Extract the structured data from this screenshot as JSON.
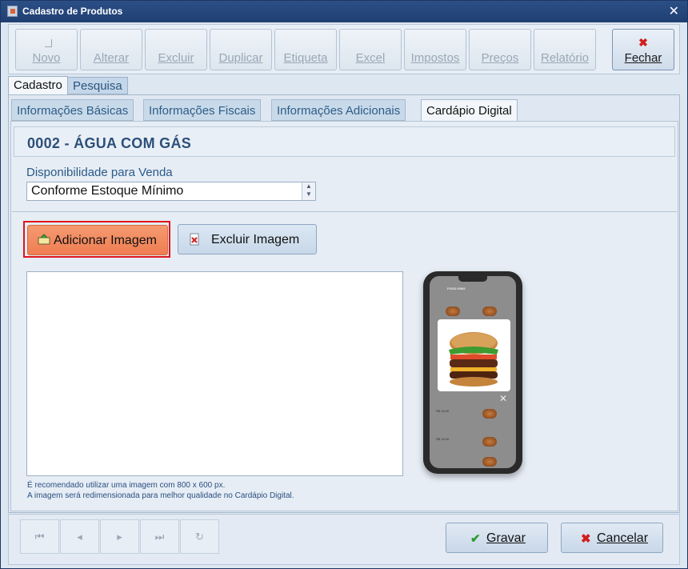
{
  "window": {
    "title": "Cadastro de Produtos",
    "close_glyph": "✕"
  },
  "toolbar": {
    "buttons": [
      {
        "label": "Novo",
        "enabled": false
      },
      {
        "label": "Alterar",
        "enabled": false
      },
      {
        "label": "Excluir",
        "enabled": false
      },
      {
        "label": "Duplicar",
        "enabled": false
      },
      {
        "label": "Etiqueta",
        "enabled": false
      },
      {
        "label": "Excel",
        "enabled": false
      },
      {
        "label": "Impostos",
        "enabled": false
      },
      {
        "label": "Preços",
        "enabled": false
      },
      {
        "label": "Relatório",
        "enabled": false
      }
    ],
    "close_label": "Fechar",
    "close_icon": "red-x-icon"
  },
  "main_tabs": [
    {
      "label": "Cadastro",
      "selected": true
    },
    {
      "label": "Pesquisa",
      "selected": false
    }
  ],
  "sub_tabs": [
    {
      "label": "Informações Básicas",
      "selected": false
    },
    {
      "label": "Informações Fiscais",
      "selected": false
    },
    {
      "label": "Informações Adicionais",
      "selected": false
    },
    {
      "label": "Cardápio Digital",
      "selected": true
    }
  ],
  "product": {
    "title": "0002 - ÁGUA COM GÁS"
  },
  "availability": {
    "label": "Disponibilidade para Venda",
    "value": "Conforme Estoque Mínimo"
  },
  "image_actions": {
    "add_label": "Adicionar Imagem",
    "delete_label": "Excluir Imagem"
  },
  "notes": {
    "line1": "É recomendado utilizar uma imagem com 800 x  600 px.",
    "line2": "A imagem será redimensionada para melhor qualidade no Cardápio Digital."
  },
  "phone_preview": {
    "header": "FOOD KING",
    "price1": "R$ 16,00",
    "price2": "R$ 16,00"
  },
  "footer": {
    "save_label": "Gravar",
    "cancel_label": "Cancelar"
  },
  "colors": {
    "accent": "#ef7d52",
    "highlight_frame": "#e0141c",
    "title": "#2c4f7a"
  }
}
